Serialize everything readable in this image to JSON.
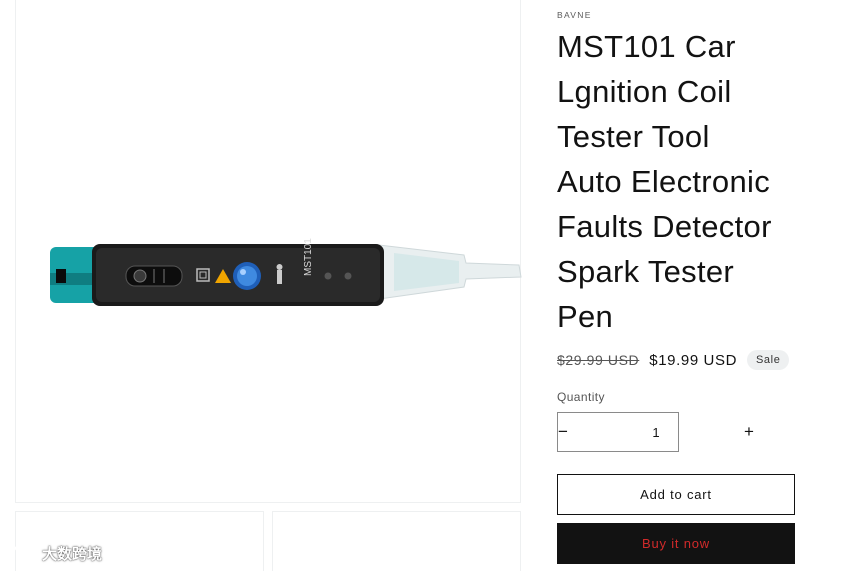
{
  "product": {
    "vendor": "BAVNE",
    "title_lines": [
      "MST101 Car",
      "Lgnition Coil",
      "Tester Tool",
      "Auto Electronic",
      "Faults Detector",
      "Spark Tester",
      "Pen"
    ],
    "device_label": "MST101",
    "price": {
      "compare_at": "$29.99 USD",
      "sale": "$19.99 USD",
      "badge": "Sale"
    }
  },
  "quantity": {
    "label": "Quantity",
    "value": "1",
    "decrease_symbol": "−",
    "increase_symbol": "+"
  },
  "buttons": {
    "add_to_cart": "Add to cart",
    "buy_now": "Buy it now"
  },
  "watermark": {
    "text": "大数跨境"
  },
  "colors": {
    "accent_teal": "#16a2a6",
    "buy_now_bg": "#121212",
    "buy_now_text": "#d12a2a",
    "badge_bg": "#eef0f1"
  }
}
